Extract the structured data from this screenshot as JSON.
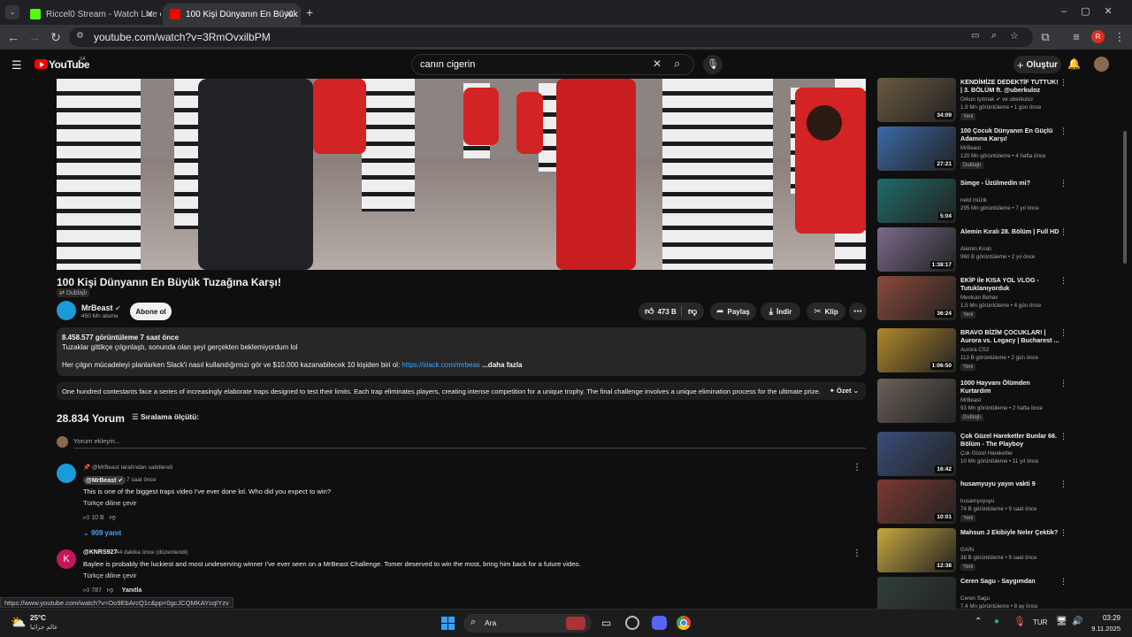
{
  "browser": {
    "tabs": [
      {
        "title": "Riccel0 Stream - Watch Live on",
        "active": false
      },
      {
        "title": "100 Kişi Dünyanın En Büyük Tuz",
        "active": true
      }
    ],
    "url": "youtube.com/watch?v=3RmOvxilbPM",
    "profile_initial": "R",
    "status_url": "https://www.youtube.com/watch?v=Oo9EbArcQ1c&pp=0gcJCQMKAYcqIYzv"
  },
  "youtube": {
    "logo": "YouTube",
    "region": "SA",
    "search_value": "canın cigerin",
    "create_label": "Oluştur"
  },
  "video": {
    "title": "100 Kişi Dünyanın En Büyük Tuzağına Karşı!",
    "dubbed_label": "Dublajlı",
    "channel": "MrBeast",
    "subscribers": "450 Mn abone",
    "subscribe_label": "Abone ol",
    "likes": "473 B",
    "share_label": "Paylaş",
    "download_label": "İndir",
    "clip_label": "Klip",
    "views_time": "8.458.577 görüntüleme  7 saat önce",
    "desc_line1": "Tuzaklar gittikçe çılgınlaştı, sonunda olan şeyi gerçekten beklemiyordum lol",
    "desc_line2": "Her çılgın mücadeleyi planlarken Slack'i nasıl kullandığımızı gör ve $10.000 kazanabilecek 10 kişiden biri ol:",
    "desc_link": "https://slack.com/mrbeas",
    "desc_more": "...daha fazla",
    "summary": "One hundred contestants face a series of increasingly elaborate traps designed to test their limits. Each trap eliminates players, creating intense competition for a unique trophy. The final challenge involves a unique elimination process for the ultimate prize.",
    "summary_label": "Özet"
  },
  "comments": {
    "count": "28.834 Yorum",
    "sort_label": "Sıralama ölçütü:",
    "add_placeholder": "Yorum ekleyin...",
    "pinned_label": "@MrBeast tarafından sabitlendi",
    "c1_author": "@MrBeast",
    "c1_time": "7 saat önce",
    "c1_text": "This is one of the biggest traps video I've ever done lol. Who did you expect to win?",
    "translate": "Türkçe diline çevir",
    "c1_likes": "10 B",
    "c1_replies": "909 yanıt",
    "c2_initial": "K",
    "c2_author": "@KNRS927",
    "c2_time": "44 dakika önce (düzenlendi)",
    "c2_text": "Baylee is probably the luckiest and most undeserving winner I've ever seen on a MrBeast Challenge. Tomer deserved to win the most, bring him back for a future video.",
    "c2_likes": "787",
    "reply_label": "Yanıtla"
  },
  "recommendations": [
    {
      "title": "KENDİMİZE DEDEKTİF TUTTUK! | 3. BÖLÜM ft. @uberkuloz",
      "channel": "Orkun Işıtmak ✔ ve uberkuloz",
      "views": "1,9 Mn görüntüleme • 1 gün önce",
      "badge": "Yeni",
      "duration": "34:09",
      "color": "#6a5a3e"
    },
    {
      "title": "100 Çocuk Dünyanın En Güçlü Adamına Karşı!",
      "channel": "MrBeast",
      "views": "120 Mn görüntüleme • 4 hafta önce",
      "badge": "Dublajlı",
      "duration": "27:21",
      "color": "#3b6aa8"
    },
    {
      "title": "Simge - Üzülmedin mi?",
      "channel": "netd müzik",
      "views": "295 Mn görüntüleme • 7 yıl önce",
      "badge": "",
      "duration": "5:04",
      "color": "#1f6b68"
    },
    {
      "title": "Alemin Kıralı 28. Bölüm | Full HD",
      "channel": "Alemin Kıralı",
      "views": "960 B görüntüleme • 2 yıl önce",
      "badge": "",
      "duration": "1:38:17",
      "color": "#7a6a8a"
    },
    {
      "title": "EKİP ile KISA YOL VLOG - Tutuklanıyorduk",
      "channel": "Mevlcan Behav",
      "views": "1,5 Mn görüntüleme • 4 gün önce",
      "badge": "Yeni",
      "duration": "36:24",
      "color": "#8a4a3a"
    },
    {
      "title": "BRAVO BİZİM ÇOCUKLAR! | Aurora vs. Legacy | Bucharest ...",
      "channel": "Aurora CS2",
      "views": "113 B görüntüleme • 2 gün önce",
      "badge": "Yeni",
      "duration": "1:06:50",
      "color": "#b0882a"
    },
    {
      "title": "1000 Hayvanı Ölümden Kurtardım",
      "channel": "MrBeast",
      "views": "93 Mn görüntüleme • 2 hafta önce",
      "badge": "Dublajlı",
      "duration": "",
      "color": "#6b6158"
    },
    {
      "title": "Çok Güzel Hareketler Bunlar 66. Bölüm - The Playboy",
      "channel": "Çok Güzel Hareketler",
      "views": "10 Mn görüntüleme • 11 yıl önce",
      "badge": "",
      "duration": "16:42",
      "color": "#3a4e7a"
    },
    {
      "title": "husamyuyu yayın vakti 9",
      "channel": "husamyuyuyu",
      "views": "74 B görüntüleme • 9 saat önce",
      "badge": "Yeni",
      "duration": "10:01",
      "color": "#7a3a30"
    },
    {
      "title": "Mahsun J Ekibiyle Neler Çektik?",
      "channel": "GAİN",
      "views": "38 B görüntüleme • 9 saat önce",
      "badge": "Yeni",
      "duration": "12:38",
      "color": "#c8a840"
    },
    {
      "title": "Ceren Sagu - Saygımdan",
      "channel": "Ceren Sagu",
      "views": "7,4 Mn görüntüleme • 8 ay önce",
      "badge": "",
      "duration": "",
      "color": "#2f3f3a"
    }
  ],
  "taskbar": {
    "temp": "25°C",
    "weather_sub": "عالم جزائيا",
    "search_label": "Ara",
    "lang": "TUR",
    "time": "03:29",
    "date": "9.11.2025"
  }
}
